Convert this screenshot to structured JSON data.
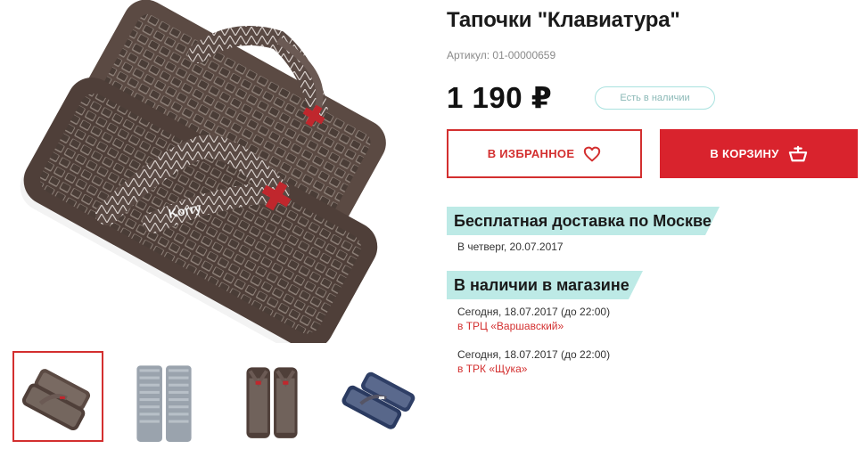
{
  "product": {
    "title": "Тапочки \"Клавиатура\"",
    "sku": "Артикул: 01-00000659",
    "price": "1 190 ₽",
    "stock_badge": "Есть в наличии"
  },
  "actions": {
    "favorite_label": "В ИЗБРАННОЕ",
    "cart_label": "В КОРЗИНУ"
  },
  "delivery": {
    "heading": "Бесплатная доставка по Москве",
    "date": "В четверг, 20.07.2017"
  },
  "stores": {
    "heading": "В наличии в магазине",
    "items": [
      {
        "date": "Сегодня, 18.07.2017 (до 22:00)",
        "store": "в ТРЦ «Варшавский»"
      },
      {
        "date": "Сегодня, 18.07.2017 (до 22:00)",
        "store": "в ТРК «Щука»"
      }
    ]
  },
  "gallery": {
    "selected_index": 0,
    "thumbnail_count": 4,
    "brand_text": "Korry"
  },
  "colors": {
    "accent_red": "#d9232d",
    "banner_teal": "#bdeae6",
    "badge_border": "#a9e2df"
  }
}
